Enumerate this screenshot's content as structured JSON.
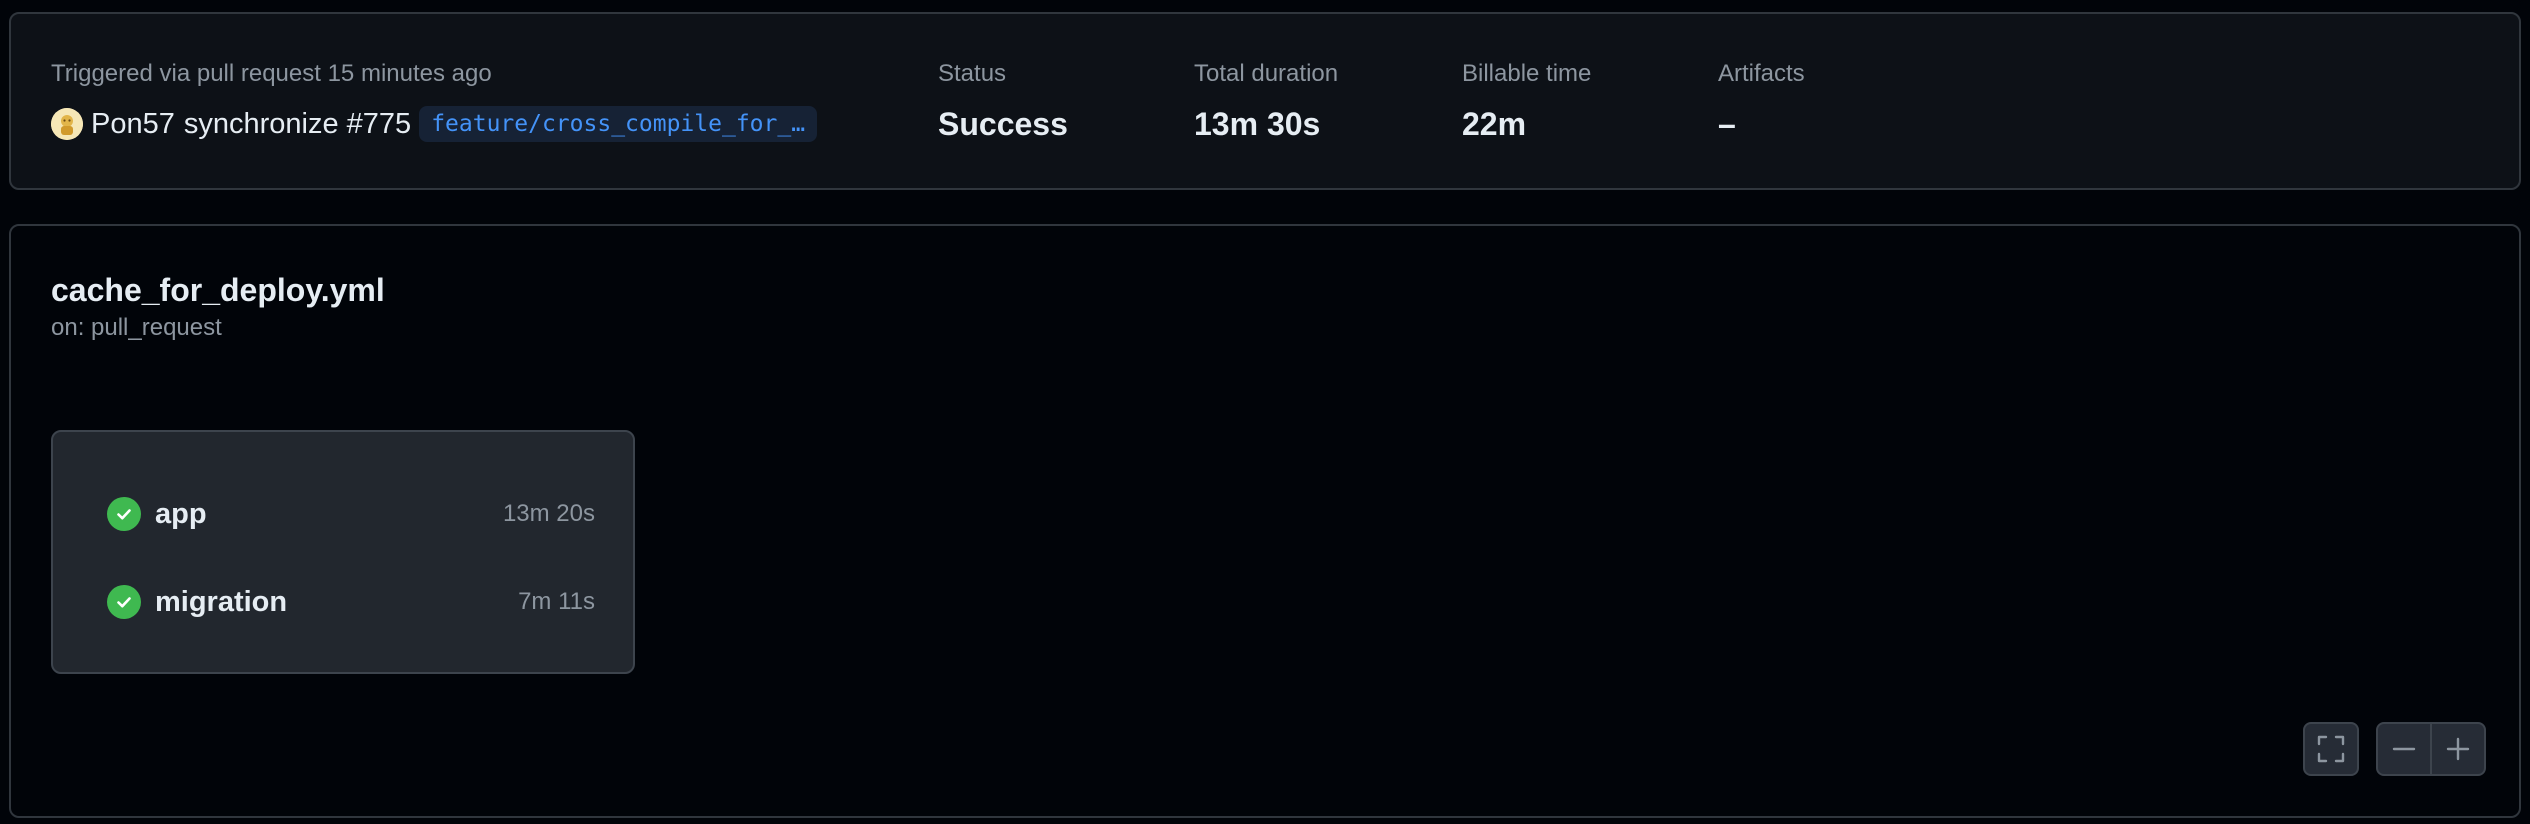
{
  "summary": {
    "trigger_label": "Triggered via pull request 15 minutes ago",
    "actor": "Pon57",
    "event_text": "synchronize #775",
    "branch": "feature/cross_compile_for_deploy",
    "status_label": "Status",
    "status_value": "Success",
    "duration_label": "Total duration",
    "duration_value": "13m 30s",
    "billable_label": "Billable time",
    "billable_value": "22m",
    "artifacts_label": "Artifacts",
    "artifacts_value": "–"
  },
  "workflow": {
    "file_name": "cache_for_deploy.yml",
    "trigger": "on: pull_request",
    "jobs": [
      {
        "name": "app",
        "duration": "13m 20s",
        "status": "success"
      },
      {
        "name": "migration",
        "duration": "7m 11s",
        "status": "success"
      }
    ]
  },
  "controls": {
    "fullscreen_icon": "fullscreen-icon",
    "zoom_out_icon": "minus-icon",
    "zoom_in_icon": "plus-icon"
  },
  "colors": {
    "success": "#3fb950",
    "branch_text": "#4493f8",
    "muted_text": "#8d96a0",
    "border": "#30363d"
  }
}
